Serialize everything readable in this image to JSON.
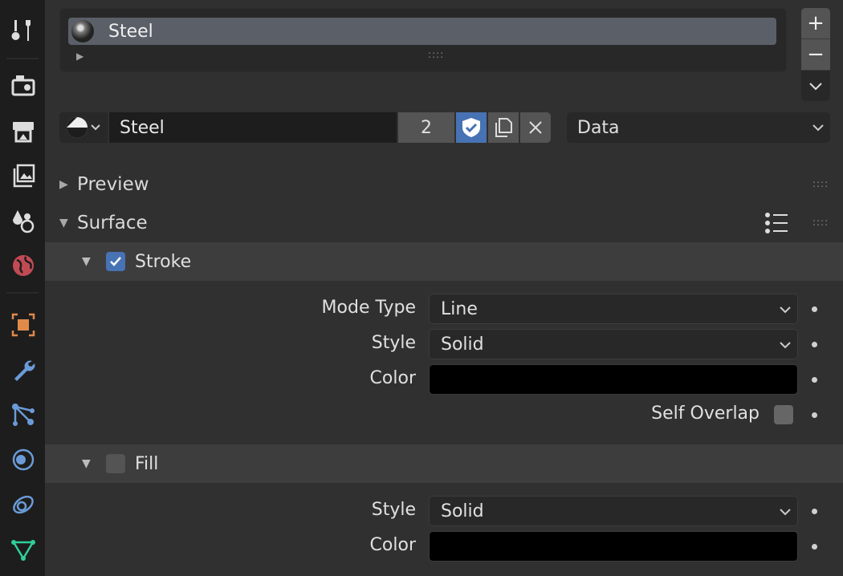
{
  "tabs": [
    {
      "name": "tool-tab",
      "icon": "tool-icon"
    },
    {
      "name": "render-tab",
      "icon": "render-icon"
    },
    {
      "name": "output-tab",
      "icon": "output-icon"
    },
    {
      "name": "view-layer-tab",
      "icon": "view-layer-icon"
    },
    {
      "name": "scene-tab",
      "icon": "scene-icon"
    },
    {
      "name": "world-tab",
      "icon": "world-icon"
    },
    {
      "name": "object-tab",
      "icon": "object-icon"
    },
    {
      "name": "modifier-tab",
      "icon": "wrench-icon"
    },
    {
      "name": "particles-tab",
      "icon": "particles-icon"
    },
    {
      "name": "physics-tab",
      "icon": "physics-icon"
    },
    {
      "name": "constraints-tab",
      "icon": "constraints-icon"
    },
    {
      "name": "data-tab",
      "icon": "data-icon"
    }
  ],
  "material_slots": {
    "items": [
      {
        "name": "Steel"
      }
    ],
    "add_label": "+",
    "remove_label": "−"
  },
  "datablock": {
    "name": "Steel",
    "users": "2",
    "link": "Data"
  },
  "panels": {
    "preview": {
      "title": "Preview"
    },
    "surface": {
      "title": "Surface"
    }
  },
  "stroke": {
    "title": "Stroke",
    "enabled": true,
    "mode_type_label": "Mode Type",
    "mode_type_value": "Line",
    "style_label": "Style",
    "style_value": "Solid",
    "color_label": "Color",
    "color_value": "#000000",
    "self_overlap_label": "Self Overlap",
    "self_overlap": false
  },
  "fill": {
    "title": "Fill",
    "enabled": false,
    "style_label": "Style",
    "style_value": "Solid",
    "color_label": "Color",
    "color_value": "#000000"
  },
  "colors": {
    "accent": "#4772b3",
    "background": "#303030",
    "tabbar": "#1d1d1d"
  }
}
